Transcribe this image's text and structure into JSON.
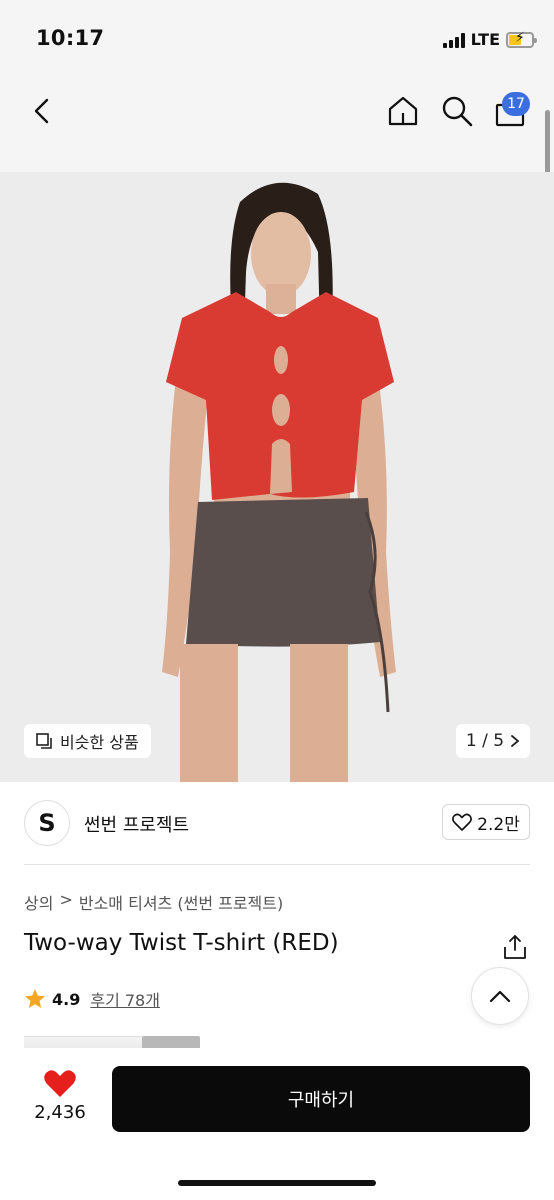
{
  "status_bar": {
    "time": "10:17",
    "network": "LTE",
    "battery_color": "#f5c518"
  },
  "nav": {
    "back_icon": "chevron-left-icon",
    "home_icon": "home-icon",
    "search_icon": "search-icon",
    "cart_icon": "shopping-bag-icon",
    "cart_count": "17",
    "badge_color": "#3b6fe0"
  },
  "gallery": {
    "similar_label": "비슷한 상품",
    "page_counter": "1 / 5",
    "top_color": "#d93a32",
    "skirt_color": "#5a4e4c",
    "background_color": "#e9e9e9"
  },
  "brand": {
    "logo_text": "S",
    "name": "썬번 프로젝트",
    "likes": "2.2만"
  },
  "product": {
    "breadcrumb": [
      "상의",
      "반소매 티셔츠 (썬번 프로젝트)"
    ],
    "title": "Two-way Twist T-shirt (RED)",
    "rating": "4.9",
    "review_label": "후기 78개"
  },
  "bottom_bar": {
    "heart_count": "2,436",
    "buy_label": "구매하기",
    "heart_color": "#e5201c"
  }
}
